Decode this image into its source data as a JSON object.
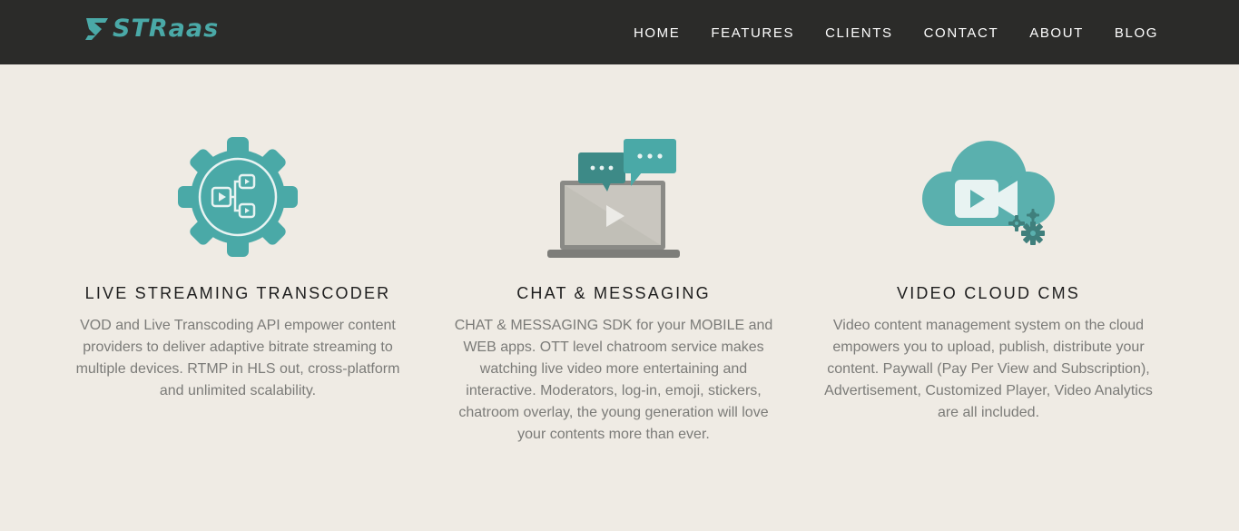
{
  "brand": {
    "logo_text": "STRaas",
    "color": "#4aa9a7"
  },
  "nav": {
    "items": [
      {
        "label": "HOME"
      },
      {
        "label": "FEATURES"
      },
      {
        "label": "CLIENTS"
      },
      {
        "label": "CONTACT"
      },
      {
        "label": "ABOUT"
      },
      {
        "label": "BLOG"
      }
    ]
  },
  "features": [
    {
      "icon": "gear-transcoder-icon",
      "title": "LIVE STREAMING TRANSCODER",
      "description": "VOD and Live Transcoding API empower content providers to deliver adaptive bitrate streaming to multiple devices. RTMP in HLS out, cross-platform and unlimited scalability."
    },
    {
      "icon": "laptop-chat-icon",
      "title": "CHAT & MESSAGING",
      "description": "CHAT & MESSAGING SDK for your MOBILE and WEB apps. OTT level chatroom service makes watching live video more entertaining and interactive. Moderators, log-in, emoji, stickers, chatroom overlay, the young generation will love your contents more than ever."
    },
    {
      "icon": "cloud-video-icon",
      "title": "VIDEO CLOUD CMS",
      "description": "Video content management system on the cloud empowers you to upload, publish, distribute your content. Paywall (Pay Per View and Subscription), Advertisement, Customized Player, Video Analytics are all included."
    }
  ],
  "colors": {
    "navbar_bg": "#2b2b29",
    "page_bg": "#efebe4",
    "accent": "#4aa9a7",
    "heading": "#1d1d1d",
    "body_text": "#7b7b78"
  }
}
